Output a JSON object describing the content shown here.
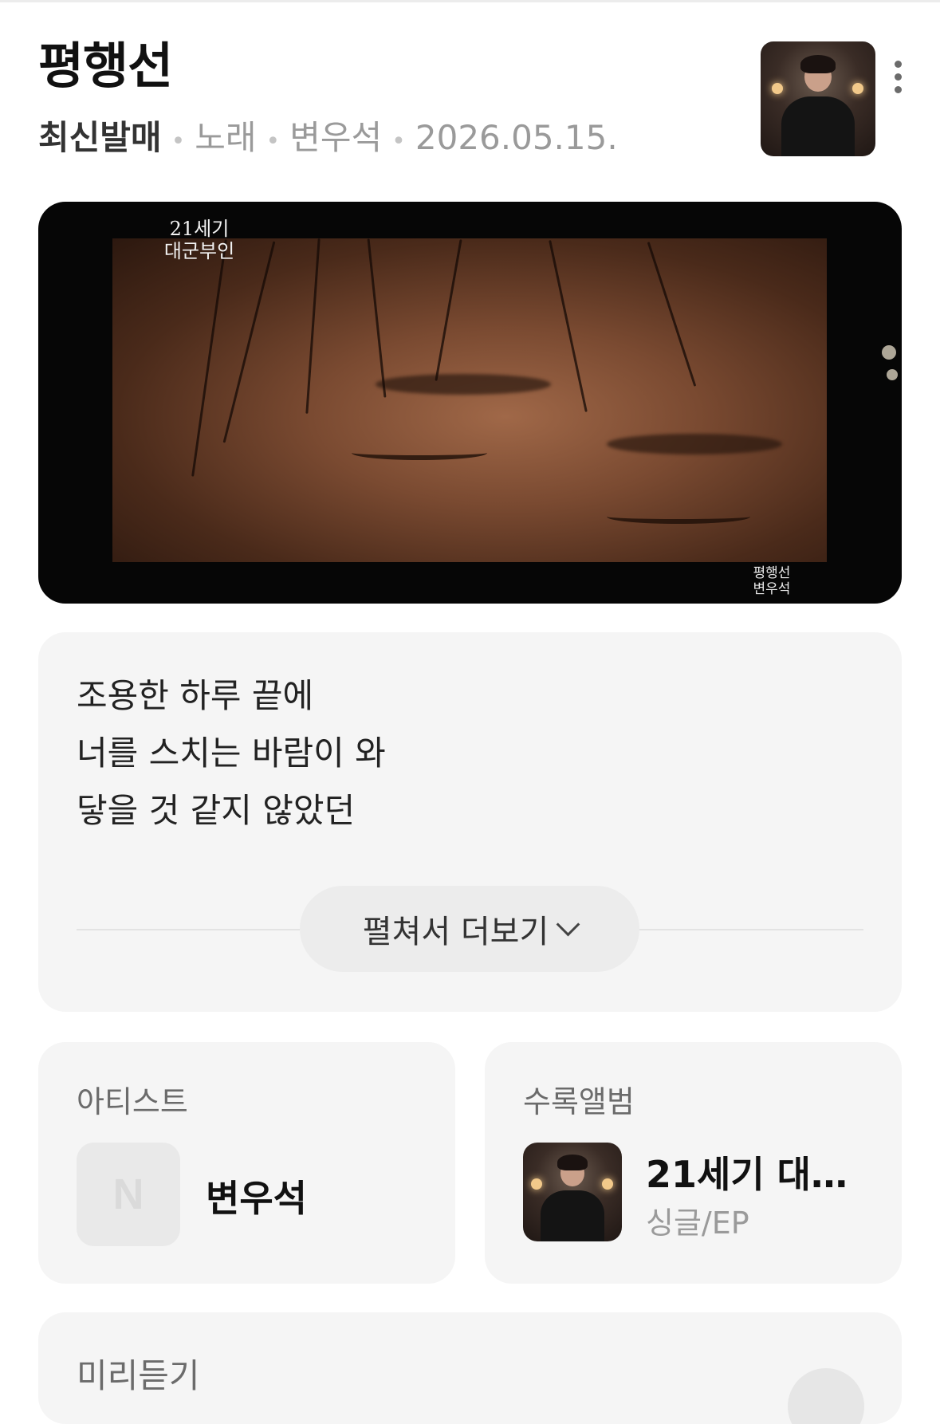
{
  "song": {
    "title": "평행선",
    "badge": "최신발매",
    "type": "노래",
    "artist": "변우석",
    "release_date": "2026.05.15."
  },
  "video": {
    "logo_top_line1": "21세기",
    "logo_top_line2": "대군부인",
    "logo_bottom_line1": "평행선",
    "logo_bottom_line2": "변우석"
  },
  "lyrics": {
    "lines": [
      "조용한 하루 끝에",
      "너를 스치는 바람이 와",
      "닿을 것 같지 않았던"
    ],
    "expand_label": "펼쳐서 더보기"
  },
  "artist_card": {
    "heading": "아티스트",
    "avatar_placeholder": "N",
    "name": "변우석"
  },
  "album_card": {
    "heading": "수록앨범",
    "title": "21세기 대…",
    "type": "싱글/EP"
  },
  "preview_card": {
    "heading": "미리듣기"
  },
  "icons": {
    "more": "more-vertical-icon",
    "expand": "chevron-down-icon"
  },
  "colors": {
    "background": "#ffffff",
    "card": "#f5f5f5",
    "muted_text": "#9a9a9a"
  }
}
